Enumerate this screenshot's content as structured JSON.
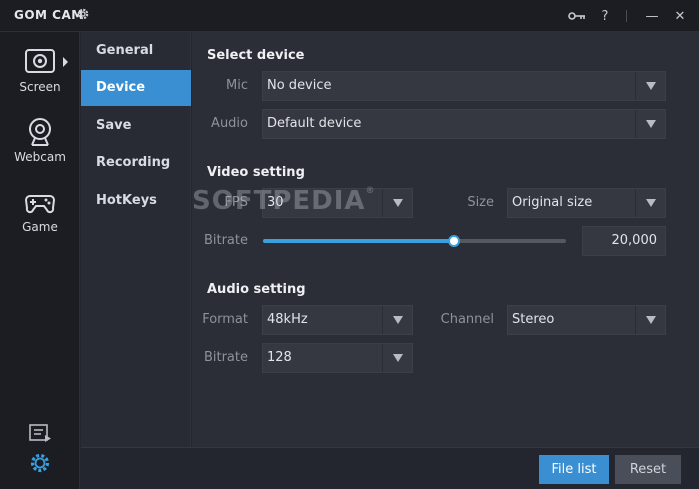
{
  "window": {
    "title": "GOM CAM",
    "icons": [
      "gear-icon",
      "key-icon",
      "help-icon",
      "minimize-icon",
      "close-icon"
    ],
    "help_label": "?",
    "minimize_label": "—",
    "close_label": "✕"
  },
  "modes": [
    {
      "label": "Screen",
      "icon": "screen-capture-icon"
    },
    {
      "label": "Webcam",
      "icon": "webcam-icon"
    },
    {
      "label": "Game",
      "icon": "gamepad-icon"
    }
  ],
  "nav": {
    "items": [
      {
        "label": "General"
      },
      {
        "label": "Device"
      },
      {
        "label": "Save"
      },
      {
        "label": "Recording"
      },
      {
        "label": "HotKeys"
      }
    ],
    "active": "Device"
  },
  "select_device": {
    "title": "Select device",
    "mic_label": "Mic",
    "mic_value": "No device",
    "audio_label": "Audio",
    "audio_value": "Default device"
  },
  "video_setting": {
    "title": "Video setting",
    "fps_label": "FPS",
    "fps_value": "30",
    "size_label": "Size",
    "size_value": "Original size",
    "bitrate_label": "Bitrate",
    "bitrate_value": "20,000",
    "bitrate_slider_fraction": 0.63
  },
  "audio_setting": {
    "title": "Audio setting",
    "format_label": "Format",
    "format_value": "48kHz",
    "channel_label": "Channel",
    "channel_value": "Stereo",
    "bitrate_label": "Bitrate",
    "bitrate_value": "128"
  },
  "footer": {
    "file_list_label": "File list",
    "reset_label": "Reset"
  },
  "watermark": "SOFTPEDIA",
  "colors": {
    "accent": "#3a8fd2",
    "slider": "#3aa0dc",
    "background": "#2b2e36",
    "sidebar": "#1b1d23"
  }
}
